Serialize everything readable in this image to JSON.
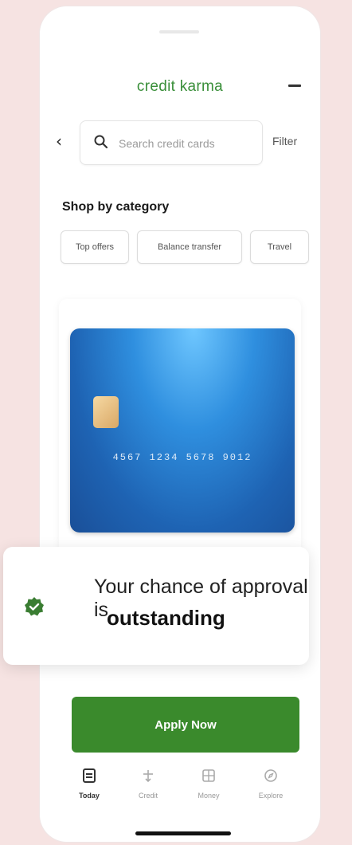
{
  "header": {
    "brand": "credit karma"
  },
  "search": {
    "placeholder": "Search credit cards"
  },
  "toolbar": {
    "filter_label": "Filter"
  },
  "category": {
    "title": "Shop by category",
    "chips": [
      "Top offers",
      "Balance transfer",
      "Travel"
    ]
  },
  "card": {
    "number": "4567 1234 5678 9012"
  },
  "approval": {
    "line1": "Your chance of approval is",
    "line2": "outstanding"
  },
  "cta": {
    "apply_label": "Apply Now"
  },
  "tabs": [
    {
      "label": "Today"
    },
    {
      "label": "Credit"
    },
    {
      "label": "Money"
    },
    {
      "label": "Explore"
    }
  ],
  "colors": {
    "brand_green": "#3a8a2c",
    "card_blue": "#1e63b3",
    "background_pink": "#f6e3e2"
  }
}
